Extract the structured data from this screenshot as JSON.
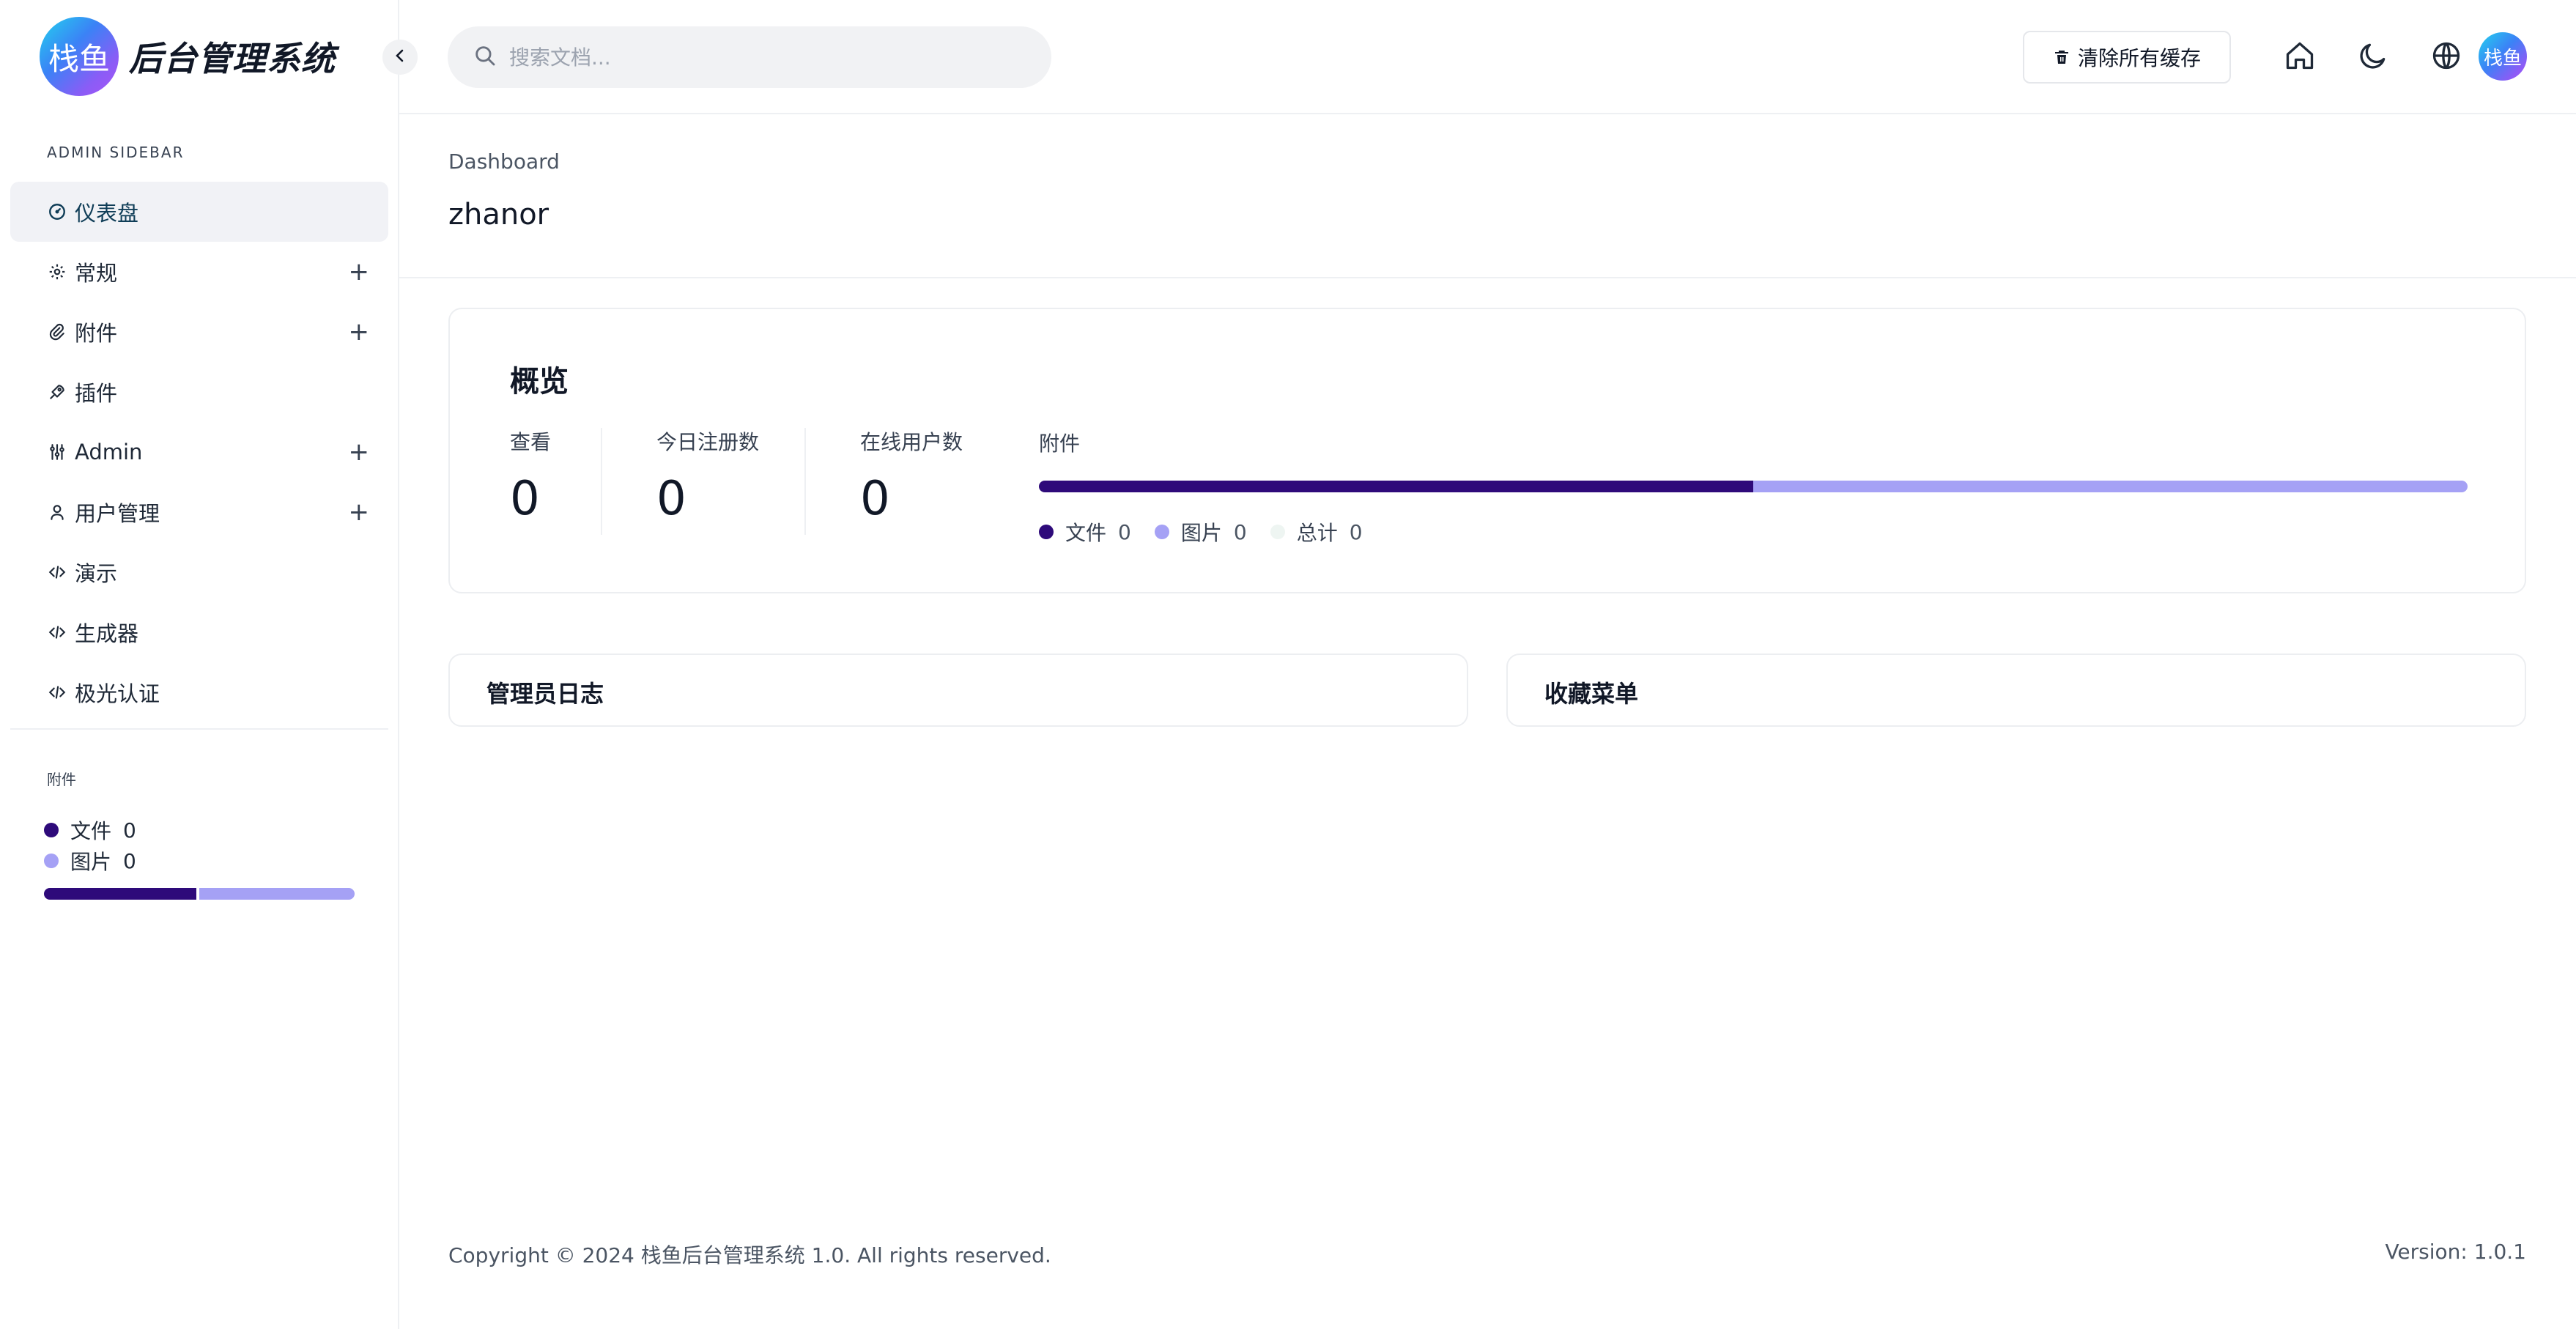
{
  "brand": {
    "logo_text": "栈鱼",
    "title": "后台管理系统"
  },
  "sidebar": {
    "title": "ADMIN SIDEBAR",
    "items": [
      {
        "label": "仪表盘",
        "icon": "dashboard-icon",
        "active": true,
        "expandable": false
      },
      {
        "label": "常规",
        "icon": "gear-icon",
        "expandable": true
      },
      {
        "label": "附件",
        "icon": "paperclip-icon",
        "expandable": true
      },
      {
        "label": "插件",
        "icon": "rocket-icon",
        "expandable": false
      },
      {
        "label": "Admin",
        "icon": "sliders-icon",
        "expandable": true
      },
      {
        "label": "用户管理",
        "icon": "user-icon",
        "expandable": true
      },
      {
        "label": "演示",
        "icon": "code-icon",
        "expandable": false
      },
      {
        "label": "生成器",
        "icon": "code-icon",
        "expandable": false
      },
      {
        "label": "极光认证",
        "icon": "code-icon",
        "expandable": false
      }
    ],
    "attachment": {
      "title": "附件",
      "files_label": "文件",
      "files_count": "0",
      "images_label": "图片",
      "images_count": "0",
      "files_fraction": 0.49
    }
  },
  "header": {
    "search_placeholder": "搜索文档...",
    "clear_cache_label": "清除所有缓存",
    "avatar_text": "栈鱼"
  },
  "page": {
    "breadcrumb": "Dashboard",
    "title": "zhanor"
  },
  "overview": {
    "title": "概览",
    "stats": [
      {
        "label": "查看",
        "value": "0"
      },
      {
        "label": "今日注册数",
        "value": "0"
      },
      {
        "label": "在线用户数",
        "value": "0"
      }
    ],
    "attachments": {
      "label": "附件",
      "files_fraction": 0.5,
      "legend": [
        {
          "label": "文件",
          "value": "0",
          "color": "#2e0a7a"
        },
        {
          "label": "图片",
          "value": "0",
          "color": "#a5a1f5"
        },
        {
          "label": "总计",
          "value": "0",
          "color": "#eef5f2"
        }
      ]
    }
  },
  "panels": {
    "admin_log_title": "管理员日志",
    "favorites_title": "收藏菜单"
  },
  "footer": {
    "copyright": "Copyright © 2024 栈鱼后台管理系统 1.0. All rights reserved.",
    "version": "Version: 1.0.1"
  },
  "colors": {
    "primary": "#2e0a7a",
    "secondary": "#a5a1f5",
    "active_bg": "#f1f2f6",
    "active_text": "#0f3d57"
  }
}
